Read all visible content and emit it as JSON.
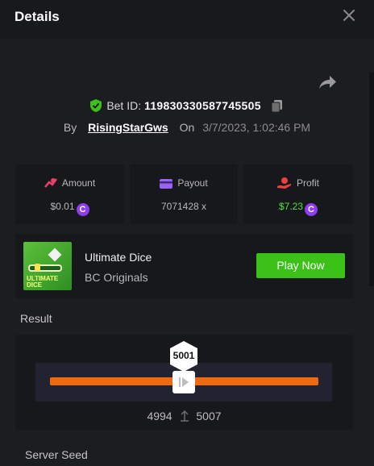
{
  "header": {
    "title": "Details",
    "close_icon": "close-icon"
  },
  "bet": {
    "id_label": "Bet ID:",
    "id_value": "119830330587745505",
    "by_label": "By",
    "username": "RisingStarGws",
    "on_label": "On",
    "datetime": "3/7/2023, 1:02:46 PM"
  },
  "stats": {
    "amount": {
      "label": "Amount",
      "value": "$0.01"
    },
    "payout": {
      "label": "Payout",
      "value": "7071428 x"
    },
    "profit": {
      "label": "Profit",
      "value": "$7.23"
    },
    "coin_symbol": "C"
  },
  "game": {
    "thumbnail_caption_line1": "ULTIMATE",
    "thumbnail_caption_line2": "DICE",
    "name": "Ultimate Dice",
    "provider": "BC Originals",
    "play_label": "Play Now"
  },
  "result": {
    "label": "Result",
    "roll": "5001",
    "range_low": "4994",
    "range_high": "5007"
  },
  "server_seed": {
    "label": "Server Seed"
  },
  "colors": {
    "accent_green": "#3bc117",
    "profit_green": "#4ee13b",
    "range_orange": "#ee6a12",
    "coin_purple": "#8f3cf0"
  }
}
